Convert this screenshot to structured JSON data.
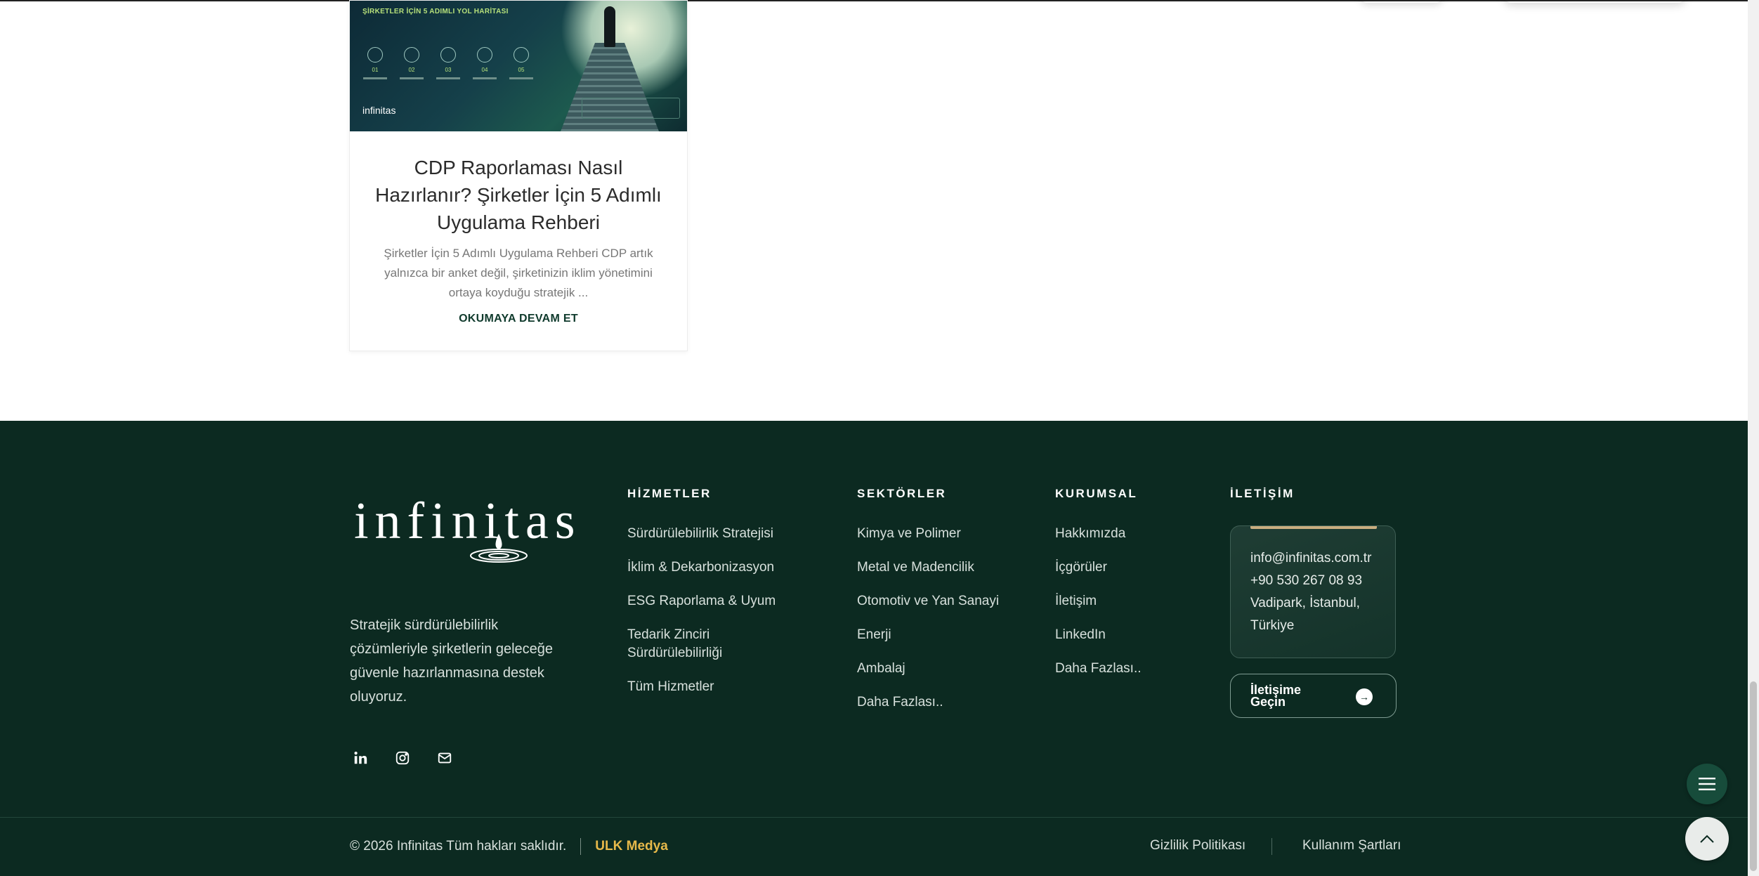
{
  "card": {
    "image": {
      "heading": "ŞİRKETLER İÇİN 5 ADIMLI YOL HARİTASI",
      "steps": [
        "01",
        "02",
        "03",
        "04",
        "05"
      ],
      "brand": "infinitas"
    },
    "title": "CDP Raporlaması Nasıl Hazırlanır? Şirketler İçin 5 Adımlı Uygulama Rehberi",
    "excerpt": "Şirketler İçin 5 Adımlı Uygulama Rehberi CDP artık yalnızca bir anket değil, şirketinizin iklim yönetimini ortaya koyduğu stratejik ...",
    "read_more": "OKUMAYA DEVAM ET"
  },
  "footer": {
    "logo": "infinitas",
    "tagline": "Stratejik sürdürülebilirlik çözümleriyle şirketlerin geleceğe güvenle hazırlanmasına destek oluyoruz.",
    "social": [
      "linkedin-icon",
      "instagram-icon",
      "mail-icon"
    ],
    "services": {
      "title": "HİZMETLER",
      "items": [
        "Sürdürülebilirlik Stratejisi",
        "İklim & Dekarbonizasyon",
        "ESG Raporlama & Uyum",
        "Tedarik Zinciri Sürdürülebilirliği",
        "Tüm Hizmetler"
      ]
    },
    "sectors": {
      "title": "SEKTÖRLER",
      "items": [
        "Kimya ve Polimer",
        "Metal ve Madencilik",
        "Otomotiv ve Yan Sanayi",
        "Enerji",
        "Ambalaj",
        "Daha Fazlası.."
      ]
    },
    "corporate": {
      "title": "KURUMSAL",
      "items": [
        "Hakkımızda",
        "İçgörüler",
        "İletişim",
        "LinkedIn",
        "Daha Fazlası.."
      ]
    },
    "contact": {
      "title": "İLETİŞİM",
      "email": "info@infinitas.com.tr",
      "phone": "+90 530 267 08 93",
      "address_line1": "Vadipark, İstanbul,",
      "address_line2": "Türkiye",
      "button": "İletişime Geçin"
    },
    "copyright": "© 2026 Infinitas Tüm hakları saklıdır.",
    "agency": "ULK Medya",
    "privacy": "Gizlilik Politikası",
    "terms": "Kullanım Şartları"
  },
  "colors": {
    "footer_bg": "#0c2a21",
    "accent_gold": "#e7b94a",
    "link_green": "#0f3a2c"
  }
}
